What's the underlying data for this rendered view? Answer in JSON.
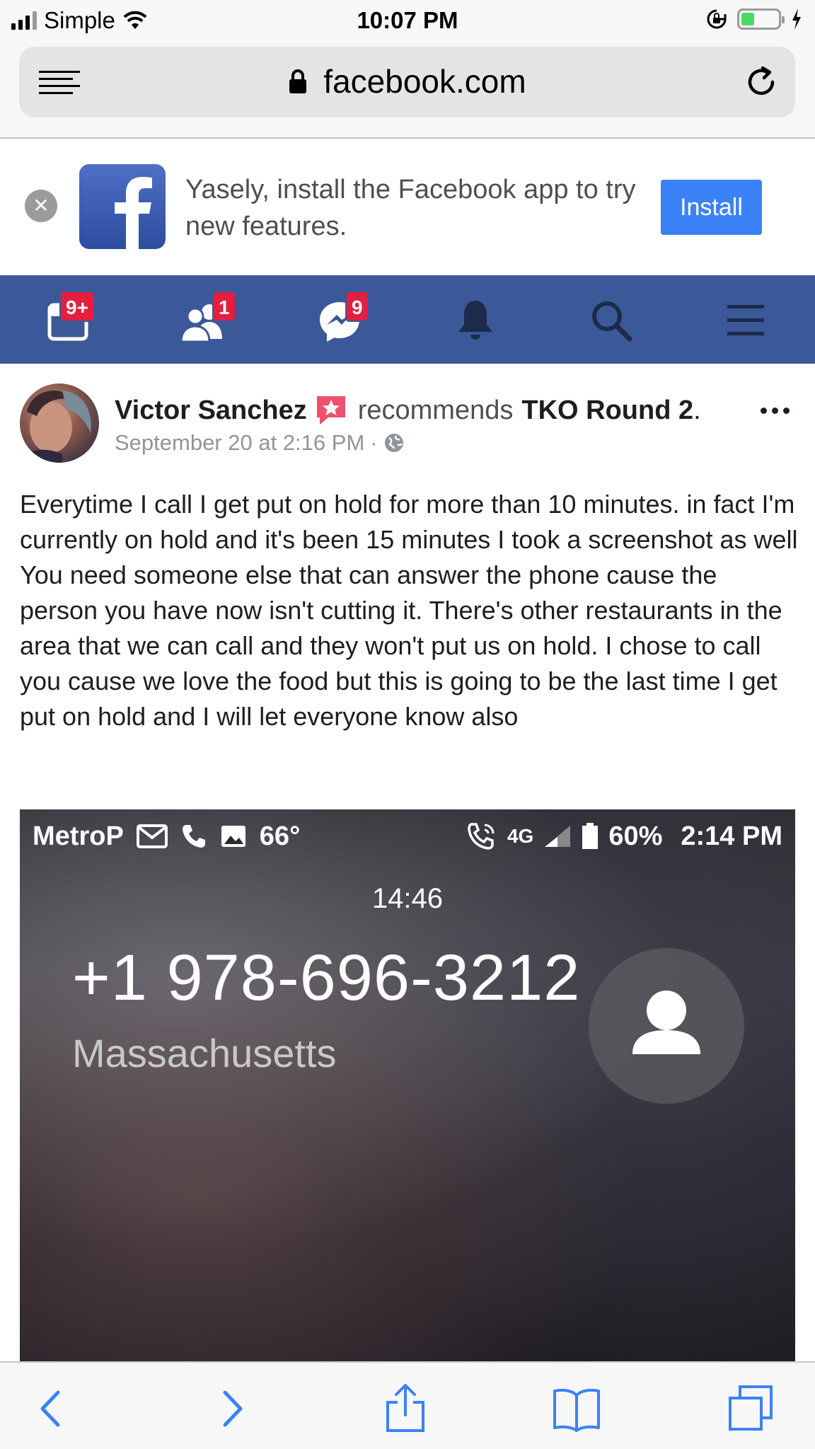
{
  "status_bar": {
    "carrier": "Simple",
    "time": "10:07 PM",
    "battery_level": 0.35,
    "icons": [
      "signal-icon",
      "wifi-icon",
      "rotation-lock-icon",
      "battery-icon",
      "charging-bolt-icon"
    ]
  },
  "browser": {
    "url": "facebook.com",
    "icons": [
      "reader-menu-icon",
      "lock-icon",
      "reload-icon"
    ]
  },
  "banner": {
    "message": "Yasely, install the Facebook app to try new features.",
    "install_label": "Install"
  },
  "fb_nav": {
    "items": [
      {
        "name": "news-feed",
        "badge": "9+"
      },
      {
        "name": "friend-requests",
        "badge": "1"
      },
      {
        "name": "messages",
        "badge": "9"
      },
      {
        "name": "notifications",
        "badge": ""
      },
      {
        "name": "search",
        "badge": ""
      },
      {
        "name": "menu",
        "badge": ""
      }
    ]
  },
  "post": {
    "author": "Victor Sanchez",
    "action": "recommends",
    "place": "TKO Round 2",
    "place_suffix": ".",
    "date": "September 20 at 2:16 PM",
    "date_separator": "·",
    "body": "Everytime I call I get put on hold for more than 10 minutes. in fact I'm currently on hold and it's been 15 minutes I took a screenshot as well You need someone else that can answer the phone cause the person you have now isn't cutting it. There's other restaurants in the area that we can call and they won't put us on hold. I chose to call you cause we love the food but this is going to be the last time I get put on hold and I will let everyone know also"
  },
  "post_image": {
    "carrier": "MetroP",
    "temperature": "66°",
    "network": "4G",
    "battery": "60%",
    "time": "2:14 PM",
    "call_timer": "14:46",
    "phone_number": "+1 978-696-3212",
    "location": "Massachusetts"
  },
  "toolbar": {
    "items": [
      "back",
      "forward",
      "share",
      "bookmarks",
      "tabs"
    ]
  },
  "colors": {
    "fb_blue": "#3b5998",
    "badge_red": "#e41e3f",
    "install_blue": "#3b82f7",
    "ios_tint": "#3b82f7"
  }
}
